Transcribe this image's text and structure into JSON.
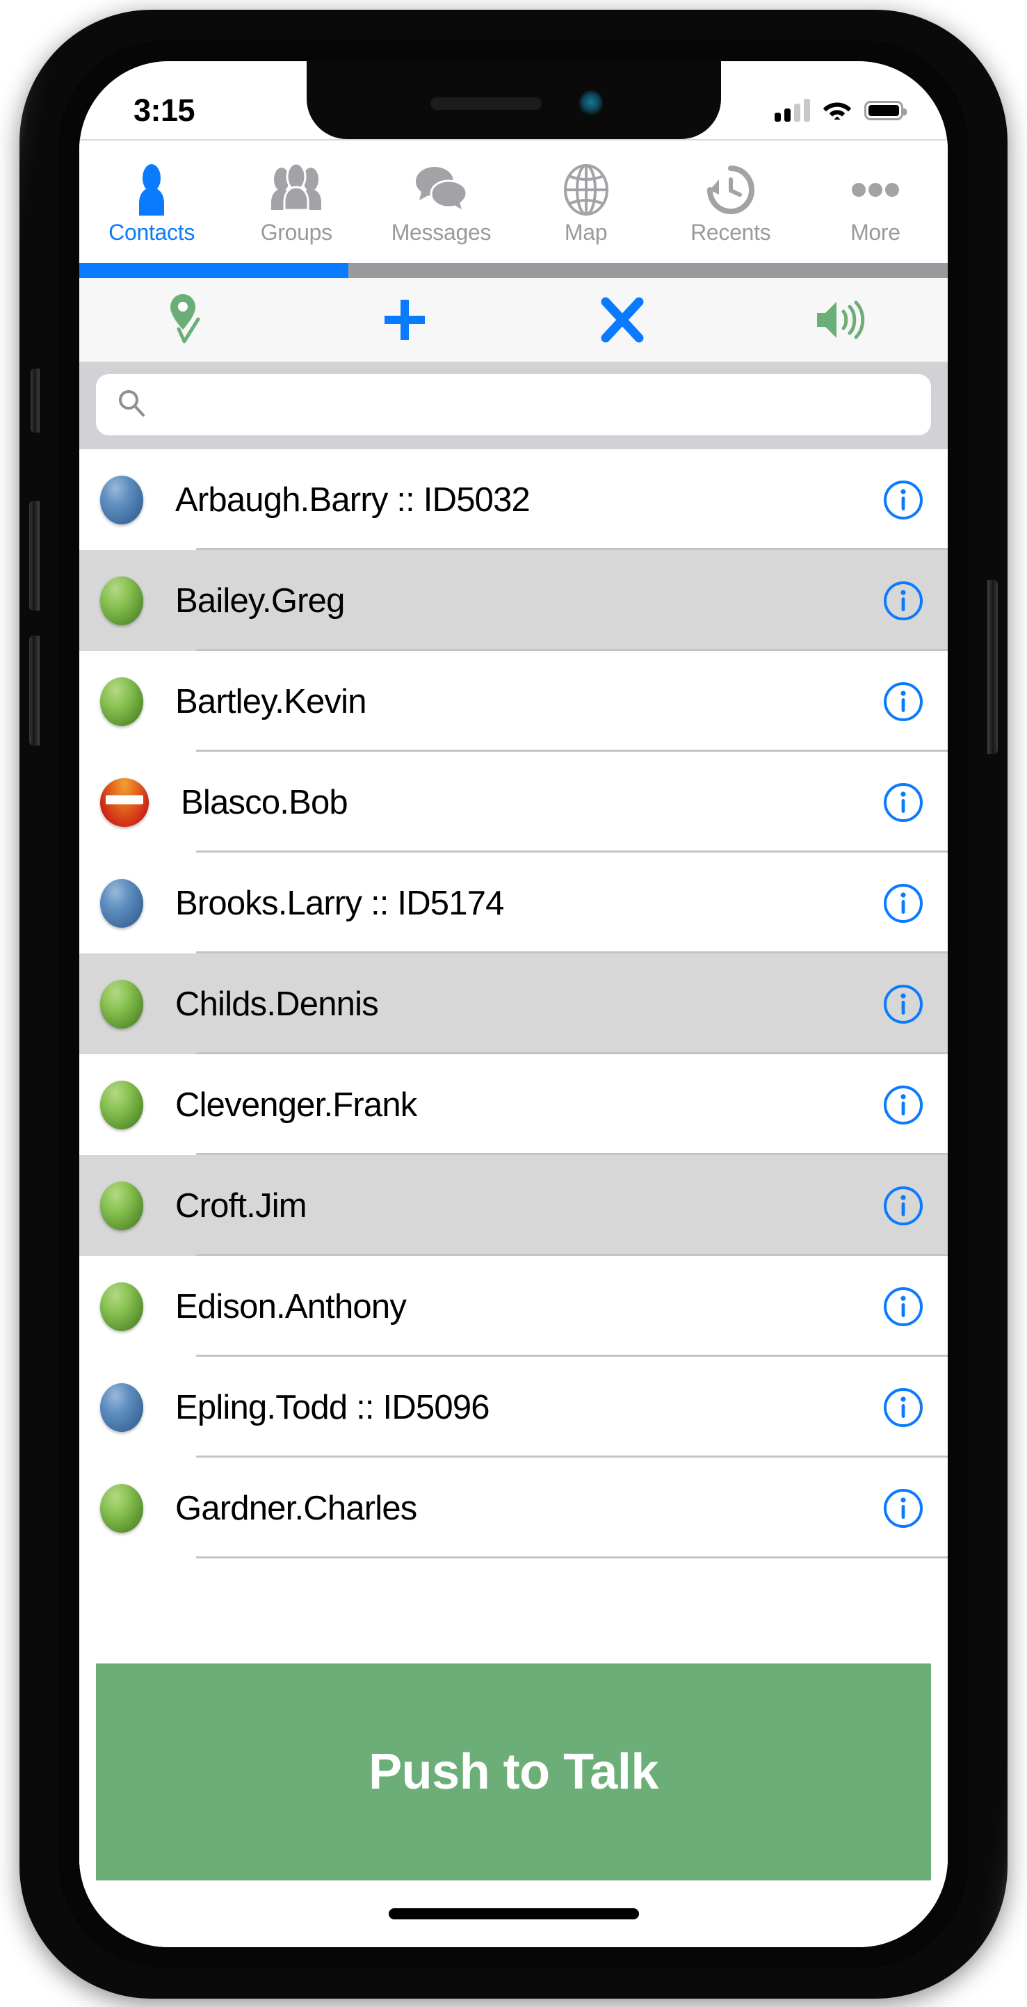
{
  "status_bar": {
    "time": "3:15",
    "signal_icon": "cellular-signal-icon",
    "signal_bars_filled": 2,
    "signal_bars_total": 4,
    "wifi_icon": "wifi-icon",
    "battery_icon": "battery-full-icon",
    "battery_level_percent": 100
  },
  "tabs": [
    {
      "label": "Contacts",
      "icon": "person-icon",
      "active": true
    },
    {
      "label": "Groups",
      "icon": "people-group-icon",
      "active": false
    },
    {
      "label": "Messages",
      "icon": "chat-bubbles-icon",
      "active": false
    },
    {
      "label": "Map",
      "icon": "globe-icon",
      "active": false
    },
    {
      "label": "Recents",
      "icon": "clock-rewind-icon",
      "active": false
    },
    {
      "label": "More",
      "icon": "ellipsis-icon",
      "active": false
    }
  ],
  "progress": {
    "fill_percent": 31,
    "fill_color": "#0a7bff",
    "track_color": "#9a9a9e"
  },
  "toolbar": [
    {
      "name": "location-check-icon",
      "label": "Location Check In",
      "color": "#6cae78"
    },
    {
      "name": "plus-icon",
      "label": "Add",
      "color": "#0a7bff"
    },
    {
      "name": "close-x-icon",
      "label": "Close",
      "color": "#0a7bff"
    },
    {
      "name": "speaker-volume-icon",
      "label": "Speaker",
      "color": "#6cae78"
    }
  ],
  "search": {
    "placeholder": "",
    "value": "",
    "icon": "search-icon"
  },
  "contacts": [
    {
      "name": "Arbaugh.Barry :: ID5032",
      "status": "blue",
      "alt": false
    },
    {
      "name": "Bailey.Greg",
      "status": "green",
      "alt": true
    },
    {
      "name": "Bartley.Kevin",
      "status": "green",
      "alt": false
    },
    {
      "name": "Blasco.Bob",
      "status": "red",
      "alt": false
    },
    {
      "name": "Brooks.Larry :: ID5174",
      "status": "blue",
      "alt": false
    },
    {
      "name": "Childs.Dennis",
      "status": "green",
      "alt": true
    },
    {
      "name": "Clevenger.Frank",
      "status": "green",
      "alt": false
    },
    {
      "name": "Croft.Jim",
      "status": "green",
      "alt": true
    },
    {
      "name": "Edison.Anthony",
      "status": "green",
      "alt": false
    },
    {
      "name": "Epling.Todd :: ID5096",
      "status": "blue",
      "alt": false
    },
    {
      "name": "Gardner.Charles",
      "status": "green",
      "alt": false
    }
  ],
  "info_icon": "info-circle-icon",
  "push_to_talk": {
    "label": "Push to Talk",
    "color": "#6cae78",
    "text_color": "#ffffff"
  },
  "colors": {
    "accent_blue": "#0a7bff",
    "accent_green": "#6cae78",
    "row_alt": "#d7d7d7",
    "tab_inactive": "#9a9a9e"
  }
}
